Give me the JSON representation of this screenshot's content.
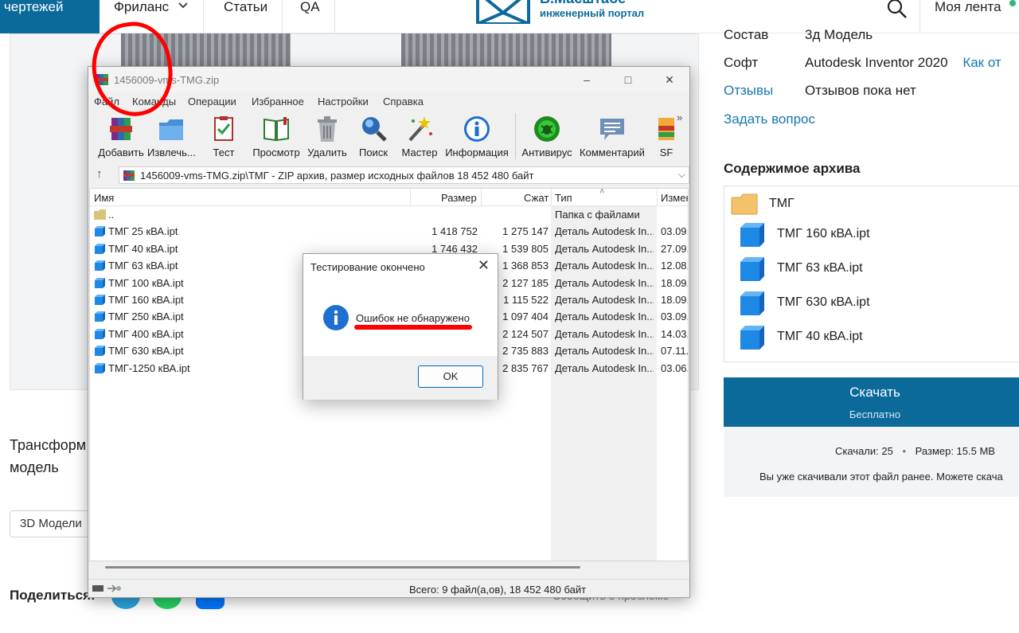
{
  "site": {
    "nav": {
      "catalog": "г чертежей",
      "freelance": "Фриланс",
      "articles": "Статьи",
      "qa": "QA",
      "feed": "Моя лента"
    },
    "logo": {
      "title": "В.Масштабе",
      "subtitle": "инженерный портал"
    },
    "colors": {
      "brand": "#0b6a9a",
      "link": "#1577b0",
      "annotation": "#ff0000"
    }
  },
  "page": {
    "title_line1": "Трансформ",
    "title_line2": "модель",
    "tag_button": "3D Модели",
    "share_label": "Поделиться:",
    "footer_partial": "Сообщить о проблеме"
  },
  "sidebar": {
    "composition_label": "Состав",
    "composition_value": "3д Модель",
    "software_label": "Софт",
    "software_value": "Autodesk Inventor 2020",
    "software_link": "Как от",
    "reviews_label": "Отзывы",
    "reviews_value": "Отзывов пока нет",
    "ask_question": "Задать вопрос",
    "archive_heading": "Содержимое архива",
    "archive_items": [
      {
        "name": "ТМГ",
        "icon": "folder-icon"
      },
      {
        "name": "ТМГ 160 кВА.ipt",
        "icon": "part-cube-icon"
      },
      {
        "name": "ТМГ 63 кВА.ipt",
        "icon": "part-cube-icon"
      },
      {
        "name": "ТМГ 630 кВА.ipt",
        "icon": "part-cube-icon"
      },
      {
        "name": "ТМГ 40 кВА.ipt",
        "icon": "part-cube-icon"
      }
    ],
    "download": {
      "label": "Скачать",
      "sublabel": "Бесплатно",
      "downloads_label": "Скачали: 25",
      "bullet": "•",
      "size_label": "Размер: 15.5 MB",
      "note": "Вы уже скачивали этот файл ранее. Можете скача"
    }
  },
  "rar": {
    "title": "1456009-vms-TMG.zip",
    "menu": [
      "Файл",
      "Команды",
      "Операции",
      "Избранное",
      "Настройки",
      "Справка"
    ],
    "toolbar": [
      {
        "label": "Добавить",
        "icon": "add-archive-icon"
      },
      {
        "label": "Извлечь...",
        "icon": "extract-icon"
      },
      {
        "label": "Тест",
        "icon": "test-icon"
      },
      {
        "label": "Просмотр",
        "icon": "view-icon"
      },
      {
        "label": "Удалить",
        "icon": "delete-icon"
      },
      {
        "label": "Поиск",
        "icon": "find-icon"
      },
      {
        "label": "Мастер",
        "icon": "wizard-icon"
      },
      {
        "label": "Информация",
        "icon": "info-icon"
      },
      {
        "label": "Антивирус",
        "icon": "antivirus-icon"
      },
      {
        "label": "Комментарий",
        "icon": "comment-icon"
      },
      {
        "label": "SF",
        "icon": "sfx-icon"
      }
    ],
    "path": "1456009-vms-TMG.zip\\ТМГ - ZIP архив, размер исходных файлов 18 452 480 байт",
    "columns": {
      "name": "Имя",
      "size": "Размер",
      "packed": "Сжат",
      "type": "Тип",
      "modified": "Измен"
    },
    "files": [
      {
        "name": "..",
        "size": "",
        "packed": "",
        "type": "Папка с файлами",
        "date": "",
        "icon": "folder-icon"
      },
      {
        "name": "ТМГ 25 кВА.ipt",
        "size": "1 418 752",
        "packed": "1 275 147",
        "type": "Деталь Autodesk In...",
        "date": "03.09.",
        "icon": "part-file-icon"
      },
      {
        "name": "ТМГ 40 кВА.ipt",
        "size": "1 746 432",
        "packed": "1 539 805",
        "type": "Деталь Autodesk In...",
        "date": "27.09.",
        "icon": "part-file-icon"
      },
      {
        "name": "ТМГ 63 кВА.ipt",
        "size": "",
        "packed": "1 368 853",
        "type": "Деталь Autodesk In...",
        "date": "12.08.",
        "icon": "part-file-icon"
      },
      {
        "name": "ТМГ 100 кВА.ipt",
        "size": "",
        "packed": "2 127 185",
        "type": "Деталь Autodesk In...",
        "date": "18.09.",
        "icon": "part-file-icon"
      },
      {
        "name": "ТМГ 160 кВА.ipt",
        "size": "",
        "packed": "1 115 522",
        "type": "Деталь Autodesk In...",
        "date": "18.09.",
        "icon": "part-file-icon"
      },
      {
        "name": "ТМГ 250 кВА.ipt",
        "size": "",
        "packed": "1 097 404",
        "type": "Деталь Autodesk In...",
        "date": "03.09.",
        "icon": "part-file-icon"
      },
      {
        "name": "ТМГ 400 кВА.ipt",
        "size": "",
        "packed": "2 124 507",
        "type": "Деталь Autodesk In...",
        "date": "14.03.",
        "icon": "part-file-icon"
      },
      {
        "name": "ТМГ 630 кВА.ipt",
        "size": "",
        "packed": "2 735 883",
        "type": "Деталь Autodesk In...",
        "date": "07.11.",
        "icon": "part-file-icon"
      },
      {
        "name": "ТМГ-1250 кВА.ipt",
        "size": "",
        "packed": "2 835 767",
        "type": "Деталь Autodesk In...",
        "date": "03.06.",
        "icon": "part-file-icon"
      }
    ],
    "status": "Всего: 9 файл(а,ов), 18 452 480 байт"
  },
  "dialog": {
    "title": "Тестирование окончено",
    "message": "Ошибок не обнаружено",
    "ok": "OK"
  }
}
